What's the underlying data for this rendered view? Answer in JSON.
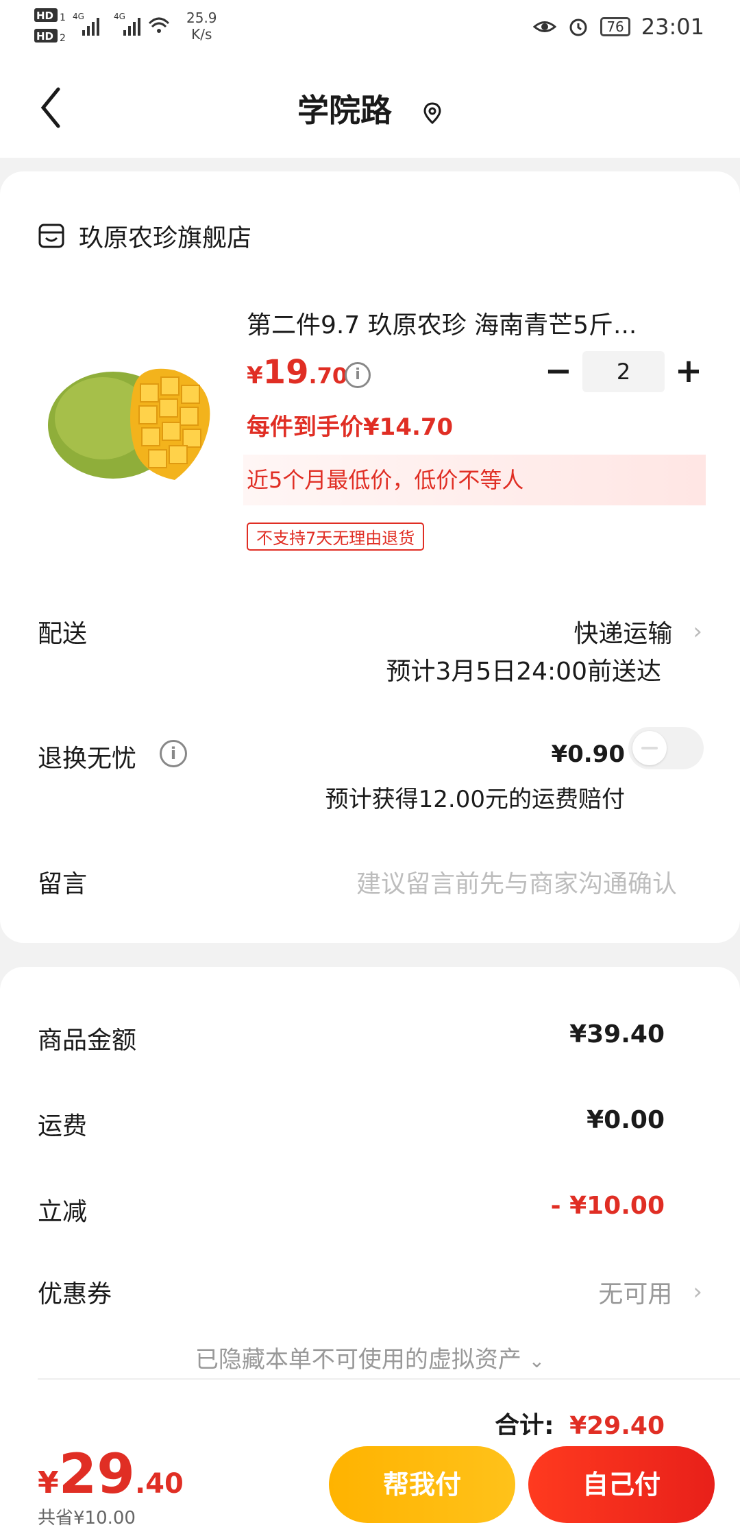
{
  "statusbar": {
    "signal_text": "HD 1 4G  4G\nHD 2",
    "net_speed": "25.9",
    "net_speed_unit": "K/s",
    "battery": "76",
    "time": "23:01"
  },
  "header": {
    "title": "学院路"
  },
  "store": {
    "name": "玖原农珍旗舰店"
  },
  "product": {
    "name": "第二件9.7 玖原农珍 海南青芒5斤...",
    "price_symbol": "¥",
    "price_int": "19",
    "price_dec": ".70",
    "quantity": "2",
    "unit_price_text": "每件到手价¥14.70",
    "low_price_banner": "近5个月最低价，低价不等人",
    "refund_badge": "不支持7天无理由退货"
  },
  "delivery": {
    "label": "配送",
    "method": "快递运输",
    "eta": "预计3月5日24:00前送达"
  },
  "return_insurance": {
    "label": "退换无忧",
    "price": "¥0.90",
    "desc": "预计获得12.00元的运费赔付",
    "enabled": false
  },
  "message": {
    "label": "留言",
    "placeholder": "建议留言前先与商家沟通确认"
  },
  "summary": {
    "goods_label": "商品金额",
    "goods_value": "¥39.40",
    "shipping_label": "运费",
    "shipping_value": "¥0.00",
    "discount_label": "立减",
    "discount_value": "- ¥10.00",
    "coupon_label": "优惠券",
    "coupon_value": "无可用",
    "hidden_assets": "已隐藏本单不可使用的虚拟资产",
    "total_label": "合计:",
    "total_value": "¥29.40"
  },
  "bottom": {
    "price_symbol": "¥",
    "price_int": "29",
    "price_dec": ".40",
    "saved": "共省¥10.00",
    "help_pay": "帮我付",
    "self_pay": "自己付"
  },
  "colors": {
    "accent_red": "#e02e24",
    "help_pay_bg": "#ffb300",
    "self_pay_bg": "#ff3a1f"
  }
}
